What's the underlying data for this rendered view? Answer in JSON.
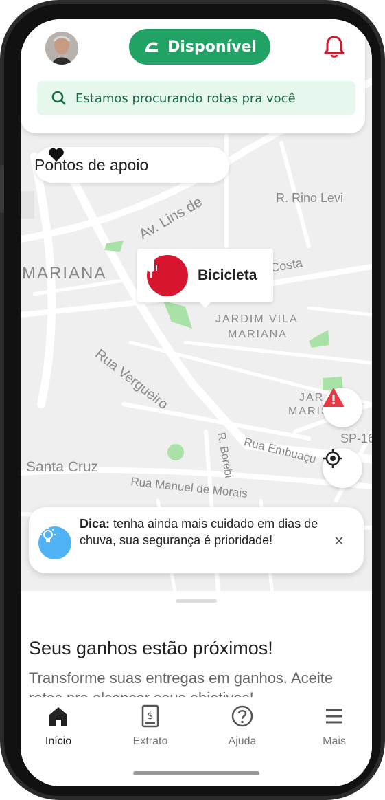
{
  "header": {
    "status_label": "Disponível",
    "notification_icon": "bell-icon",
    "search_text": "Estamos procurando rotas pra você",
    "colors": {
      "status": "#21a366",
      "bell": "#d8152f",
      "search_bg": "#e6f7ee"
    }
  },
  "map": {
    "support_label": "Pontos de apoio",
    "vehicle_label": "Bicicleta",
    "labels": {
      "av_lins": "Av. Lins de",
      "rino_levi": "R. Rino Levi",
      "costa": "Costa",
      "mariana": "MARIANA",
      "jardim1": "JARDIM VILA",
      "jardim2": "MARIANA",
      "vergueiro": "Rua Vergueiro",
      "jar": "JAR",
      "maris": "MARIS",
      "sp16": "SP-16",
      "santa_cruz": "Santa Cruz",
      "borebi": "R. Borebi",
      "embuacu": "Rua Embuaçu",
      "manuel": "Rua Manuel de Morais"
    }
  },
  "tip": {
    "prefix": "Dica:",
    "text": " tenha ainda mais cuidado em dias de chuva, sua segurança é prioridade!",
    "close": "×"
  },
  "sheet": {
    "title": "Seus ganhos estão próximos!",
    "body": "Transforme suas entregas em ganhos. Aceite rotas pra alcançar seus objetivos!"
  },
  "tabs": [
    {
      "label": "Início",
      "icon": "home-icon"
    },
    {
      "label": "Extrato",
      "icon": "statement-icon"
    },
    {
      "label": "Ajuda",
      "icon": "help-icon"
    },
    {
      "label": "Mais",
      "icon": "menu-icon"
    }
  ]
}
